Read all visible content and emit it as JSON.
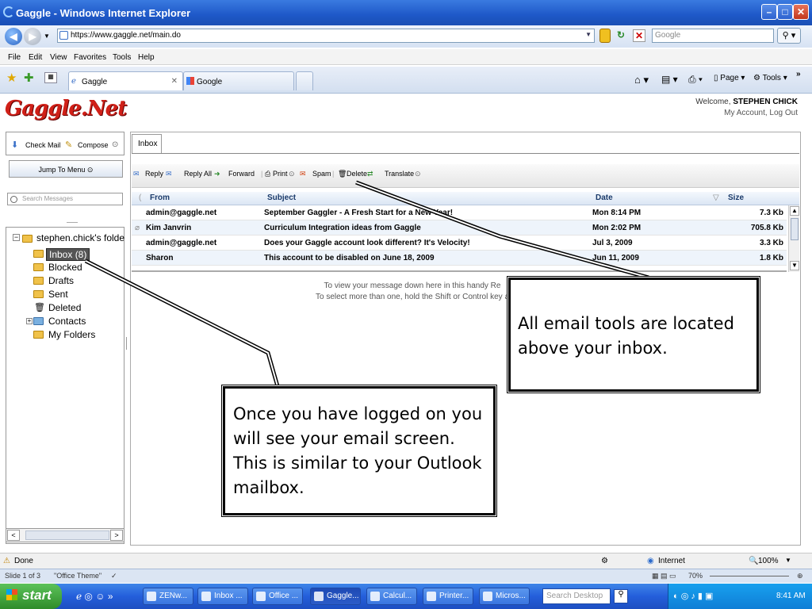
{
  "window": {
    "title": "Gaggle - Windows Internet Explorer"
  },
  "address": {
    "url": "https://www.gaggle.net/main.do",
    "search_placeholder": "Google"
  },
  "menu": [
    "File",
    "Edit",
    "View",
    "Favorites",
    "Tools",
    "Help"
  ],
  "tabs": [
    {
      "label": "Gaggle"
    },
    {
      "label": "Google"
    }
  ],
  "commandbar": {
    "page": "Page",
    "tools": "Tools"
  },
  "gaggle": {
    "logo": "Gaggle.Net",
    "welcome_prefix": "Welcome,",
    "user": "STEPHEN CHICK",
    "links": "My Account, Log Out"
  },
  "left": {
    "check_mail": "Check Mail",
    "compose": "Compose",
    "jump": "Jump To Menu",
    "search_placeholder": "Search Messages",
    "root": "stephen.chick's folde",
    "folders": [
      "Inbox (8)",
      "Blocked",
      "Drafts",
      "Sent",
      "Deleted",
      "Contacts",
      "My Folders"
    ]
  },
  "inbox_tab": "Inbox",
  "toolbar": [
    "Reply",
    "Reply All",
    "Forward",
    "Print",
    "Spam",
    "Delete",
    "Translate"
  ],
  "columns": {
    "from": "From",
    "subject": "Subject",
    "date": "Date",
    "size": "Size"
  },
  "messages": [
    {
      "from": "admin@gaggle.net",
      "subject": "September Gaggler - A Fresh Start for a New Year!",
      "date": "Mon 8:14 PM",
      "size": "7.3 Kb"
    },
    {
      "from": "Kim Janvrin",
      "subject": "Curriculum Integration ideas from Gaggle",
      "date": "Mon 2:02 PM",
      "size": "705.8 Kb"
    },
    {
      "from": "admin@gaggle.net",
      "subject": "Does your Gaggle account look different? It's Velocity!",
      "date": "Jul 3, 2009",
      "size": "3.3 Kb"
    },
    {
      "from": "Sharon",
      "subject": "This account to be disabled on June 18, 2009",
      "date": "Jun 11, 2009",
      "size": "1.8 Kb"
    }
  ],
  "preview": {
    "line1": "To view your message down here in this handy Re",
    "line2": "To select more than one, hold the Shift or Control key a"
  },
  "callouts": {
    "tools": "All email tools are located above your inbox.",
    "logged": "Once you have logged on you will see your email screen. This is similar to your Outlook mailbox."
  },
  "status": {
    "left": "Done",
    "zone": "Internet",
    "zoom": "100%"
  },
  "ppt": {
    "slide": "Slide 1 of 3",
    "theme": "\"Office Theme\"",
    "zoom": "70%"
  },
  "taskbar": {
    "start": "start",
    "tasks": [
      "ZENw...",
      "Inbox ...",
      "Office ...",
      "Gaggle...",
      "Calcul...",
      "Printer...",
      "Micros..."
    ],
    "search": "Search Desktop",
    "time": "8:41 AM"
  }
}
